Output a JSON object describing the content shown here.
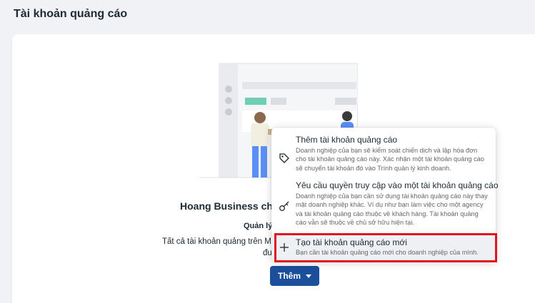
{
  "page": {
    "title": "Tài khoản quảng cáo"
  },
  "main": {
    "business_name": "Hoang Business chu",
    "manage_label": "Quản lý",
    "description_line1": "Tất cả tài khoản quảng trên Meta",
    "description_line2": "đu",
    "add_button_label": "Thêm"
  },
  "dropdown": {
    "items": [
      {
        "icon": "tag-icon",
        "title": "Thêm tài khoản quảng cáo",
        "description": "Doanh nghiệp của bạn sẽ kiểm soát chiến dịch và lập hóa đơn cho tài khoản quảng cáo này. Xác nhận một tài khoản quảng cáo sẽ chuyển tài khoản đó vào Trình quản lý kinh doanh."
      },
      {
        "icon": "key-icon",
        "title": "Yêu cầu quyền truy cập vào một tài khoản quảng cáo",
        "description": "Doanh nghiệp của bạn cần sử dụng tài khoản quảng cáo này thay mặt doanh nghiệp khác. Ví dụ như bạn làm việc cho một agency và tài khoản quảng cáo thuộc về khách hàng. Tài khoản quảng cáo vẫn sẽ thuộc về chủ sở hữu hiện tại."
      },
      {
        "icon": "plus-icon",
        "title": "Tạo tài khoản quảng cáo mới",
        "description": "Bạn cần tài khoản quảng cáo mới cho doanh nghiệp của mình."
      }
    ]
  },
  "colors": {
    "primary_button": "#1b4f9c",
    "highlight_border": "#e0141e",
    "illustration_green": "#6fcfb5",
    "illustration_blue": "#5b8ef5"
  }
}
